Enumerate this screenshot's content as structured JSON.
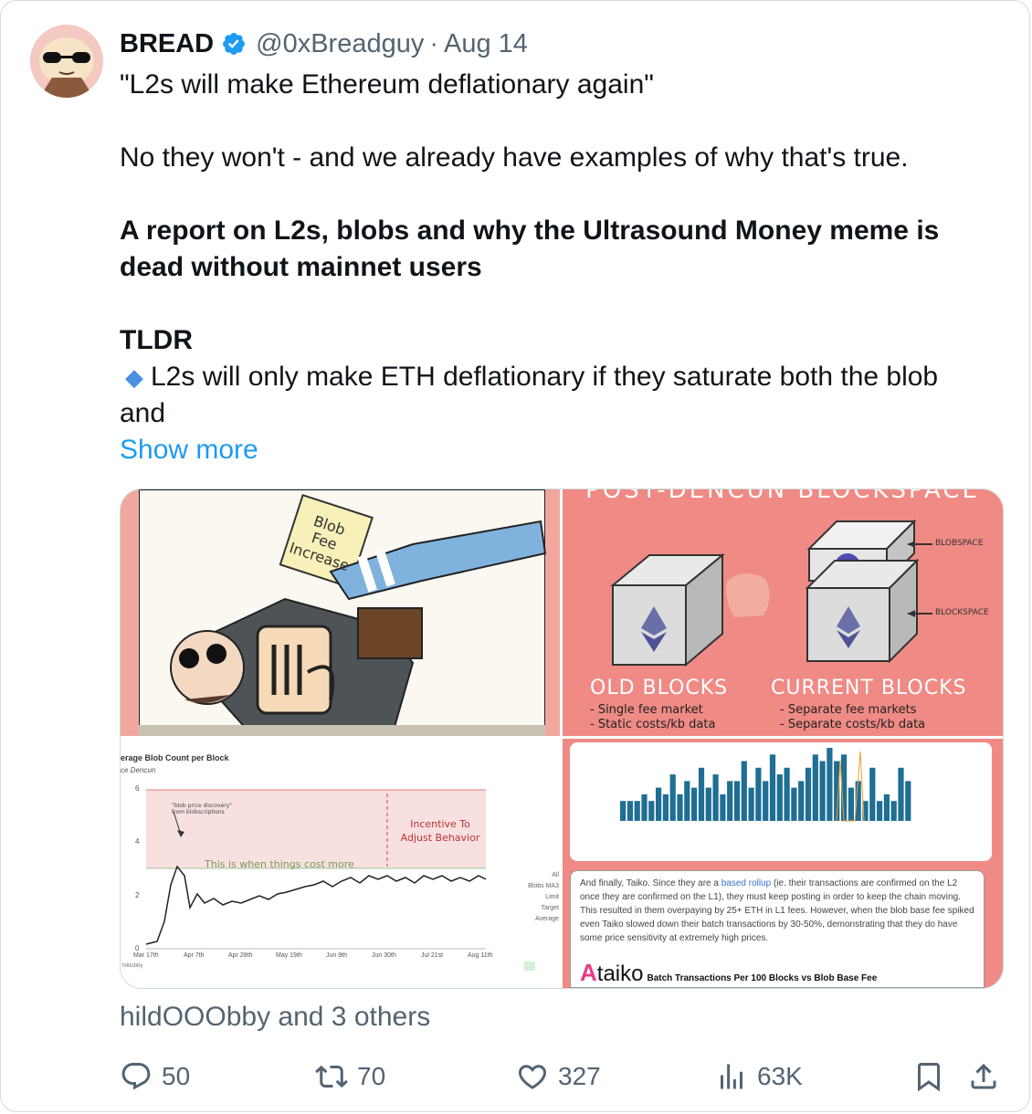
{
  "author": {
    "name": "BREAD",
    "handle": "@0xBreadguy",
    "separator": "·",
    "date": "Aug 14"
  },
  "tweet": {
    "line1": "\"L2s will make Ethereum deflationary again\"",
    "line2": "No they won't - and we already have examples of why that's true.",
    "headline": "A report on L2s, blobs and why the Ultrasound Money meme is dead without mainnet users",
    "tldr": "TLDR",
    "bullet": "L2s will only make ETH deflationary if they saturate both the blob and",
    "show_more": "Show more"
  },
  "media": {
    "panel1": {
      "sign_lines": [
        "Blob",
        "Fee",
        "Increase"
      ]
    },
    "panel2": {
      "banner": "POST-DENCUN BLOCKSPACE",
      "blobspace_label": "BLOBSPACE",
      "blockspace_label": "BLOCKSPACE",
      "old_title": "OLD BLOCKS",
      "old_items": [
        "- Single fee market",
        "- Static costs/kb data"
      ],
      "current_title": "CURRENT BLOCKS",
      "current_items": [
        "- Separate fee markets",
        "- Separate costs/kb data"
      ]
    },
    "panel3": {
      "title": "erage Blob Count per Block",
      "subtitle": "ce Dencun",
      "yticks": [
        "6",
        "4",
        "2",
        "0"
      ],
      "xticks": [
        "Mar 17th",
        "Apr 7th",
        "Apr 28th",
        "May 19th",
        "Jun 9th",
        "Jun 30th",
        "Jul 21st",
        "Aug 11th"
      ],
      "note_small": "\"blob price discovery\" from blobscriptions",
      "note_cost": "This is when things cost more",
      "note_incentive1": "Incentive To",
      "note_incentive2": "Adjust Behavior",
      "legend": [
        "All",
        "Blobs MA3",
        "Limit",
        "Target",
        "Average"
      ],
      "credit": "hildobby"
    },
    "panel4": {
      "text_before": "And finally, Taiko. Since they are a ",
      "link": "based rollup",
      "text_after": " (ie. their transactions are confirmed on the L2 once they are confirmed on the L1), they must keep posting in order to keep the chain moving. This resulted in them overpaying by 25+ ETH in L1 fees. However, when the blob base fee spiked even Taiko slowed down their batch transactions by 30-50%, demonstrating that they do have some price sensitivity at extremely high prices.",
      "brand": "taiko",
      "chart_title": "Batch Transactions Per 100 Blocks vs Blob Base Fee",
      "bars": [
        3,
        3,
        3,
        4,
        3,
        5,
        4,
        7,
        4,
        6,
        5,
        8,
        5,
        7,
        4,
        6,
        6,
        9,
        5,
        8,
        6,
        10,
        7,
        8,
        5,
        6,
        8,
        10,
        9,
        11,
        9,
        10,
        5,
        6,
        3,
        8,
        3,
        4,
        3,
        8,
        6
      ]
    }
  },
  "liked_by": "hildOOObby and 3 others",
  "actions": {
    "replies": "50",
    "reposts": "70",
    "likes": "327",
    "views": "63K"
  },
  "colors": {
    "link": "#1d9bf0",
    "verified": "#1d9bf0",
    "muted": "#536471",
    "salmon": "#ef8a84",
    "bar": "#1f6e93"
  }
}
